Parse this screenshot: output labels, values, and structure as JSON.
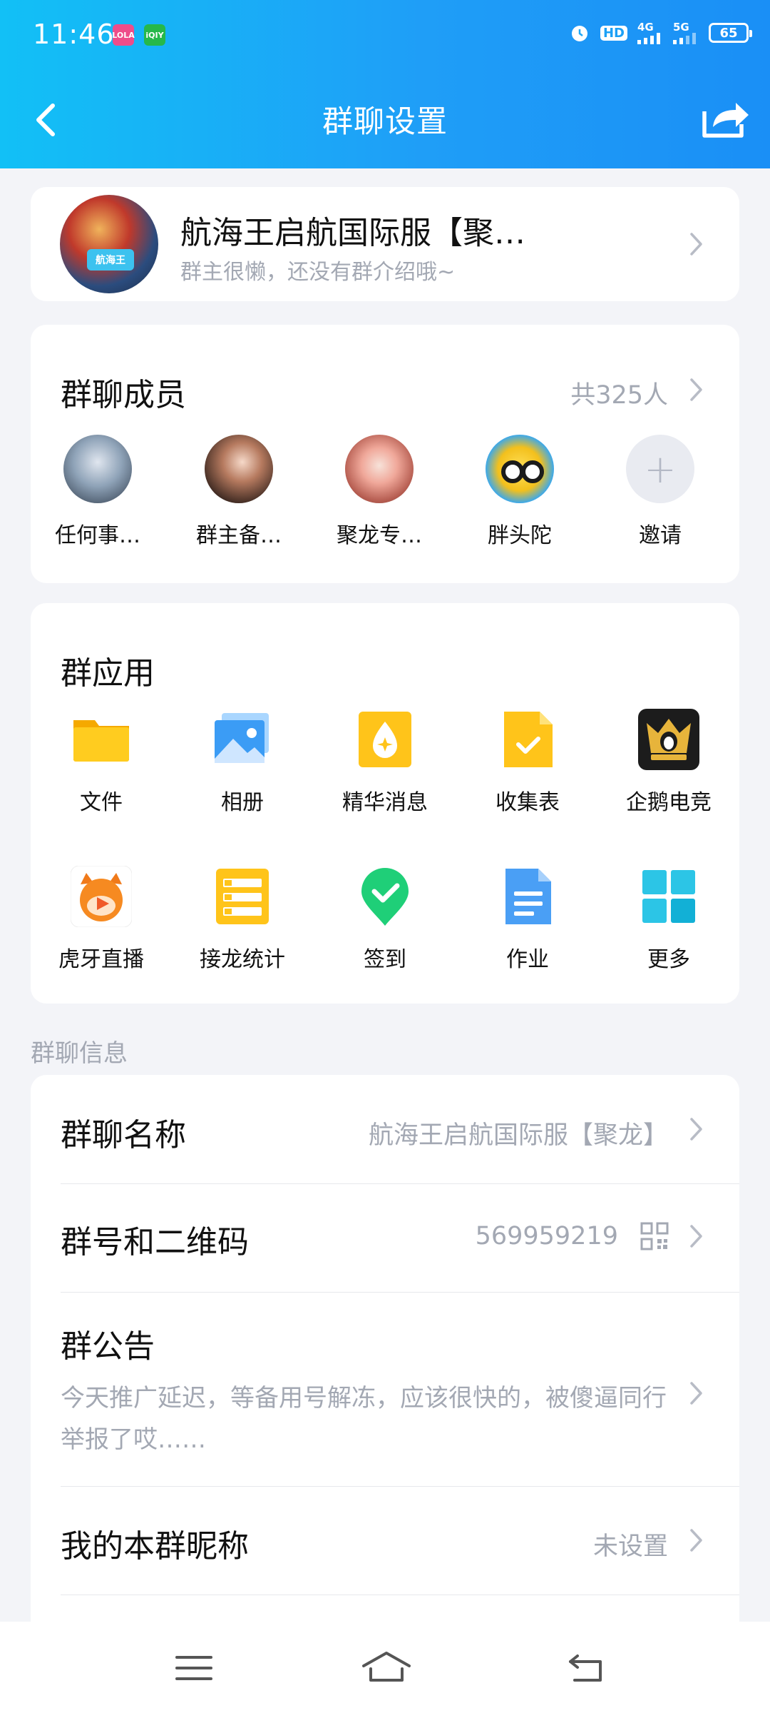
{
  "status_bar": {
    "time": "11:46",
    "badge1": "LOLA",
    "badge2": "iQIY",
    "network1": "4G",
    "network2": "5G",
    "hd": "HD",
    "battery": "65"
  },
  "header": {
    "title": "群聊设置"
  },
  "group": {
    "name": "航海王启航国际服【聚…",
    "description": "群主很懒，还没有群介绍哦~",
    "avatar_label": "航海王"
  },
  "members": {
    "title": "群聊成员",
    "count": "共325人",
    "list": [
      {
        "name": "任何事…"
      },
      {
        "name": "群主备…"
      },
      {
        "name": "聚龙专…"
      },
      {
        "name": "胖头陀"
      },
      {
        "name": "邀请"
      }
    ]
  },
  "apps": {
    "title": "群应用",
    "items": [
      {
        "label": "文件",
        "icon": "folder-icon"
      },
      {
        "label": "相册",
        "icon": "photo-album-icon"
      },
      {
        "label": "精华消息",
        "icon": "essence-message-icon"
      },
      {
        "label": "收集表",
        "icon": "collection-form-icon"
      },
      {
        "label": "企鹅电竞",
        "icon": "penguin-esports-icon"
      },
      {
        "label": "虎牙直播",
        "icon": "huya-live-icon"
      },
      {
        "label": "接龙统计",
        "icon": "chain-stats-icon"
      },
      {
        "label": "签到",
        "icon": "check-in-icon"
      },
      {
        "label": "作业",
        "icon": "homework-icon"
      },
      {
        "label": "更多",
        "icon": "more-grid-icon"
      }
    ]
  },
  "info": {
    "section_label": "群聊信息",
    "name_row": {
      "title": "群聊名称",
      "value": "航海王启航国际服【聚龙】"
    },
    "number_row": {
      "title": "群号和二维码",
      "value": "569959219"
    },
    "notice_row": {
      "title": "群公告",
      "text": "今天推广延迟，等备用号解冻，应该很快的，被傻逼同行举报了哎……"
    },
    "nickname_row": {
      "title": "我的本群昵称",
      "value": "未设置"
    }
  },
  "navbar": {
    "menu": "menu-icon",
    "home": "home-icon",
    "back": "back-icon"
  }
}
